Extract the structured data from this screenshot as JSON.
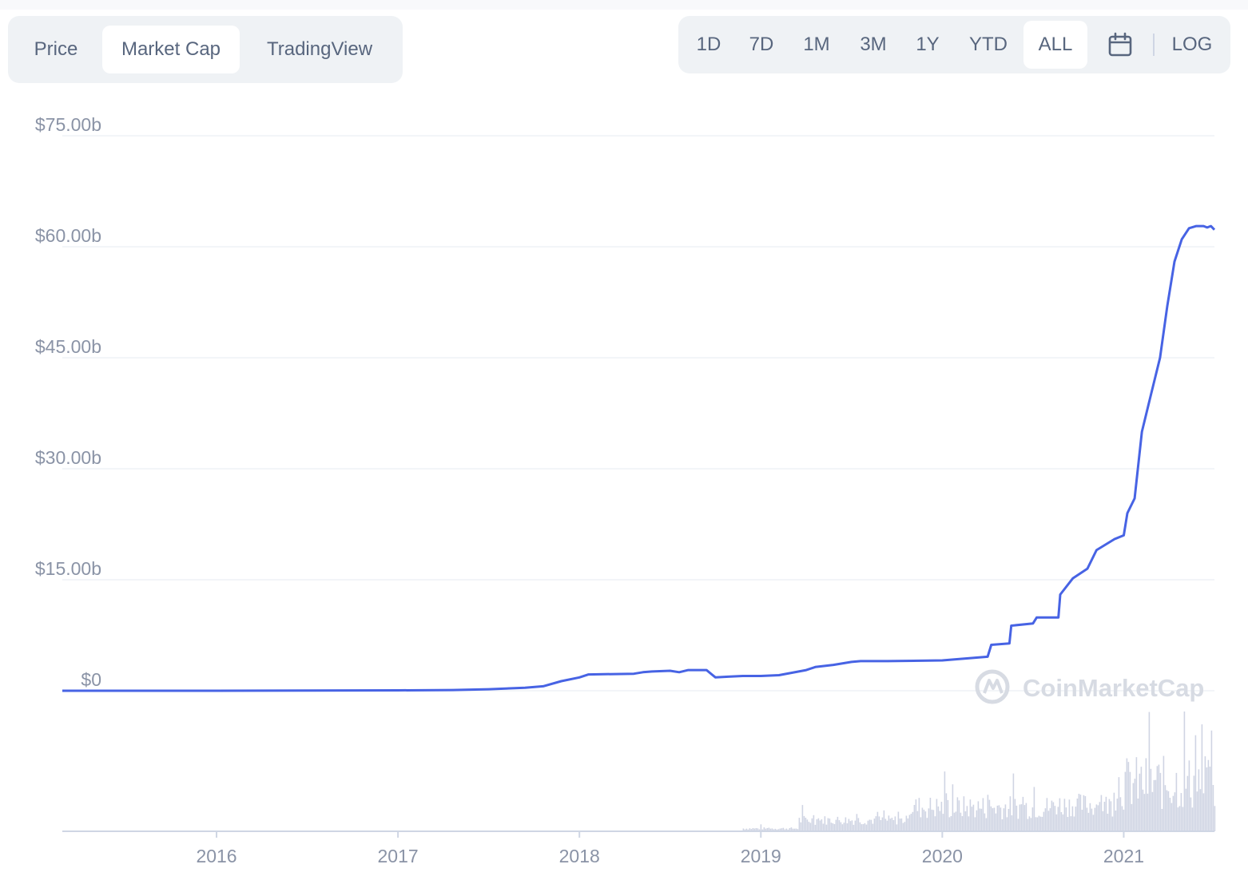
{
  "tabs": [
    {
      "label": "Price",
      "active": false
    },
    {
      "label": "Market Cap",
      "active": true
    },
    {
      "label": "TradingView",
      "active": false
    }
  ],
  "ranges": [
    {
      "label": "1D",
      "active": false
    },
    {
      "label": "7D",
      "active": false
    },
    {
      "label": "1M",
      "active": false
    },
    {
      "label": "3M",
      "active": false
    },
    {
      "label": "1Y",
      "active": false
    },
    {
      "label": "YTD",
      "active": false
    },
    {
      "label": "ALL",
      "active": true
    }
  ],
  "calendar_icon": "calendar-icon",
  "log_label": "LOG",
  "watermark": "CoinMarketCap",
  "colors": {
    "line": "#4763e4",
    "volume": "#cfd4e3",
    "grid": "#eff2f5",
    "tick_text": "#8a93a6",
    "control_bg": "#eff2f5"
  },
  "chart_data": {
    "type": "line",
    "y_tick_labels": [
      "$0",
      "$15.00b",
      "$30.00b",
      "$45.00b",
      "$60.00b",
      "$75.00b"
    ],
    "y_ticks": [
      0,
      15,
      30,
      45,
      60,
      75
    ],
    "x_tick_labels": [
      "2016",
      "2017",
      "2018",
      "2019",
      "2020",
      "2021"
    ],
    "x_ticks": [
      2016,
      2017,
      2018,
      2019,
      2020,
      2021
    ],
    "xlim": [
      2015.15,
      2021.5
    ],
    "ylim": [
      0,
      75
    ],
    "y_unit": "billion USD",
    "grid": true,
    "series": [
      {
        "x": [
          2015.15,
          2016.0,
          2016.5,
          2017.0,
          2017.3,
          2017.5,
          2017.7,
          2017.8,
          2017.9,
          2018.0,
          2018.05,
          2018.3,
          2018.35,
          2018.4,
          2018.5,
          2018.55,
          2018.6,
          2018.7,
          2018.75,
          2018.82,
          2018.9,
          2019.0,
          2019.1,
          2019.25,
          2019.3,
          2019.4,
          2019.5,
          2019.55,
          2019.7,
          2020.0,
          2020.25,
          2020.27,
          2020.37,
          2020.38,
          2020.5,
          2020.52,
          2020.64,
          2020.65,
          2020.72,
          2020.8,
          2020.85,
          2020.95,
          2021.0,
          2021.02,
          2021.06,
          2021.1,
          2021.15,
          2021.2,
          2021.24,
          2021.28,
          2021.32,
          2021.36,
          2021.4,
          2021.44,
          2021.46,
          2021.48,
          2021.5
        ],
        "values": [
          0.0,
          0.0,
          0.02,
          0.05,
          0.1,
          0.2,
          0.4,
          0.6,
          1.3,
          1.8,
          2.2,
          2.3,
          2.5,
          2.6,
          2.7,
          2.5,
          2.8,
          2.8,
          1.8,
          1.9,
          2.0,
          2.0,
          2.1,
          2.8,
          3.2,
          3.5,
          3.9,
          4.0,
          4.0,
          4.1,
          4.6,
          6.2,
          6.4,
          8.8,
          9.1,
          9.9,
          9.9,
          13.0,
          15.2,
          16.5,
          19.0,
          20.5,
          21.0,
          24.0,
          26.0,
          35.0,
          40.0,
          45.0,
          52.0,
          58.0,
          61.0,
          62.5,
          62.8,
          62.8,
          62.6,
          62.8,
          62.3
        ]
      }
    ],
    "volume_note": "relative trading volume bars, increasing from 2019 onward"
  }
}
